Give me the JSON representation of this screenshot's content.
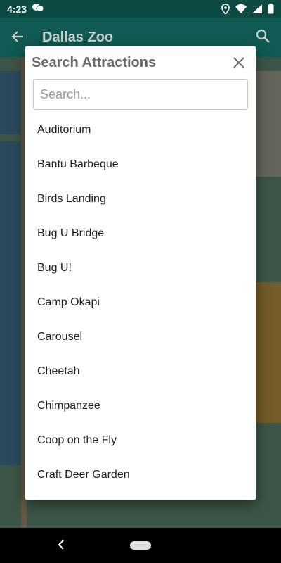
{
  "status_bar": {
    "time": "4:23"
  },
  "app_bar": {
    "title": "Dallas Zoo"
  },
  "dialog": {
    "title": "Search Attractions",
    "search_placeholder": "Search...",
    "items": [
      {
        "label": "Auditorium"
      },
      {
        "label": "Bantu Barbeque"
      },
      {
        "label": "Birds Landing"
      },
      {
        "label": "Bug U Bridge"
      },
      {
        "label": "Bug U!"
      },
      {
        "label": "Camp Okapi"
      },
      {
        "label": "Carousel"
      },
      {
        "label": "Cheetah"
      },
      {
        "label": "Chimpanzee"
      },
      {
        "label": "Coop on the Fly"
      },
      {
        "label": "Craft Deer Garden"
      }
    ]
  }
}
